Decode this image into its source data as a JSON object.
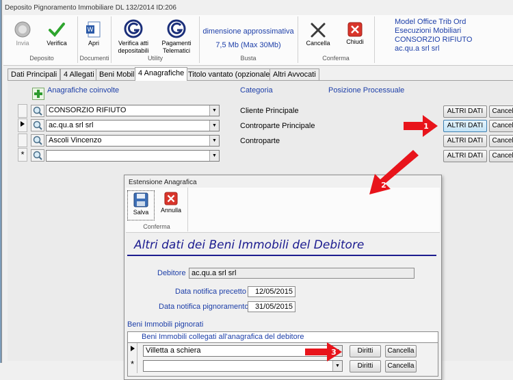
{
  "window": {
    "title": "Deposito Pignoramento Immobiliare DL 132/2014 ID:206"
  },
  "ribbon": {
    "invia_label": "Invia",
    "verifica_label": "Verifica",
    "apri_label": "Apri",
    "verifica_atti_label": "Verifica atti depositabili",
    "pagamenti_label": "Pagamenti Telematici",
    "dimension_title": "dimensione approssimativa",
    "dimension_value": "7,5 Mb (Max 30Mb)",
    "cancella_label": "Cancella",
    "chiudi_label": "Chiudi",
    "groups": {
      "deposito": "Deposito",
      "documenti": "Documenti",
      "utility": "Utility",
      "busta": "Busta",
      "conferma": "Conferma"
    },
    "info_lines": [
      "Model Office Trib Ord",
      "Esecuzioni Mobiliari",
      "CONSORZIO RIFIUTO",
      "ac.qu.a srl srl"
    ]
  },
  "tabs": [
    {
      "label": "Dati Principali"
    },
    {
      "label": "4 Allegati"
    },
    {
      "label": "Beni Mobili"
    },
    {
      "label": "4 Anagrafiche"
    },
    {
      "label": "Titolo vantato (opzionale)"
    },
    {
      "label": "Altri Avvocati"
    }
  ],
  "anagrafiche": {
    "col_anagrafiche": "Anagrafiche coinvolte",
    "col_categoria": "Categoria",
    "col_posizione": "Posizione Processuale",
    "rows": [
      {
        "name": "CONSORZIO RIFIUTO",
        "categoria": "Cliente Principale",
        "altri": "ALTRI DATI",
        "cancella": "Cancella"
      },
      {
        "name": "ac.qu.a srl srl",
        "categoria": "Controparte Principale",
        "altri": "ALTRI DATI",
        "cancella": "Cancella"
      },
      {
        "name": "Ascoli Vincenzo",
        "categoria": "Controparte",
        "altri": "ALTRI DATI",
        "cancella": "Cancella"
      },
      {
        "name": "",
        "categoria": "",
        "altri": "ALTRI DATI",
        "cancella": "Cancella"
      }
    ]
  },
  "annotations": [
    "1",
    "2",
    "3"
  ],
  "dialog": {
    "title": "Estensione Anagrafica",
    "salva_label": "Salva",
    "annulla_label": "Annulla",
    "group_conferma": "Conferma",
    "heading": "Altri dati dei Beni Immobili del Debitore",
    "debitore_label": "Debitore",
    "debitore_value": "ac.qu.a srl srl",
    "precetto_label": "Data notifica precetto",
    "precetto_value": "12/05/2015",
    "pignoramento_label": "Data notifica pignoramento",
    "pignoramento_value": "31/05/2015",
    "section_label": "Beni Immobili pignorati",
    "grid_header": "Beni Immobili collegati all'anagrafica del debitore",
    "grid_rows": [
      {
        "value": "Villetta a schiera",
        "diritti": "Diritti",
        "cancella": "Cancella"
      },
      {
        "value": "",
        "diritti": "Diritti",
        "cancella": "Cancella"
      }
    ]
  },
  "colors": {
    "label_blue": "#1c3ea8",
    "heading_navy": "#1b1b8f",
    "arrow_red": "#e8141b"
  }
}
